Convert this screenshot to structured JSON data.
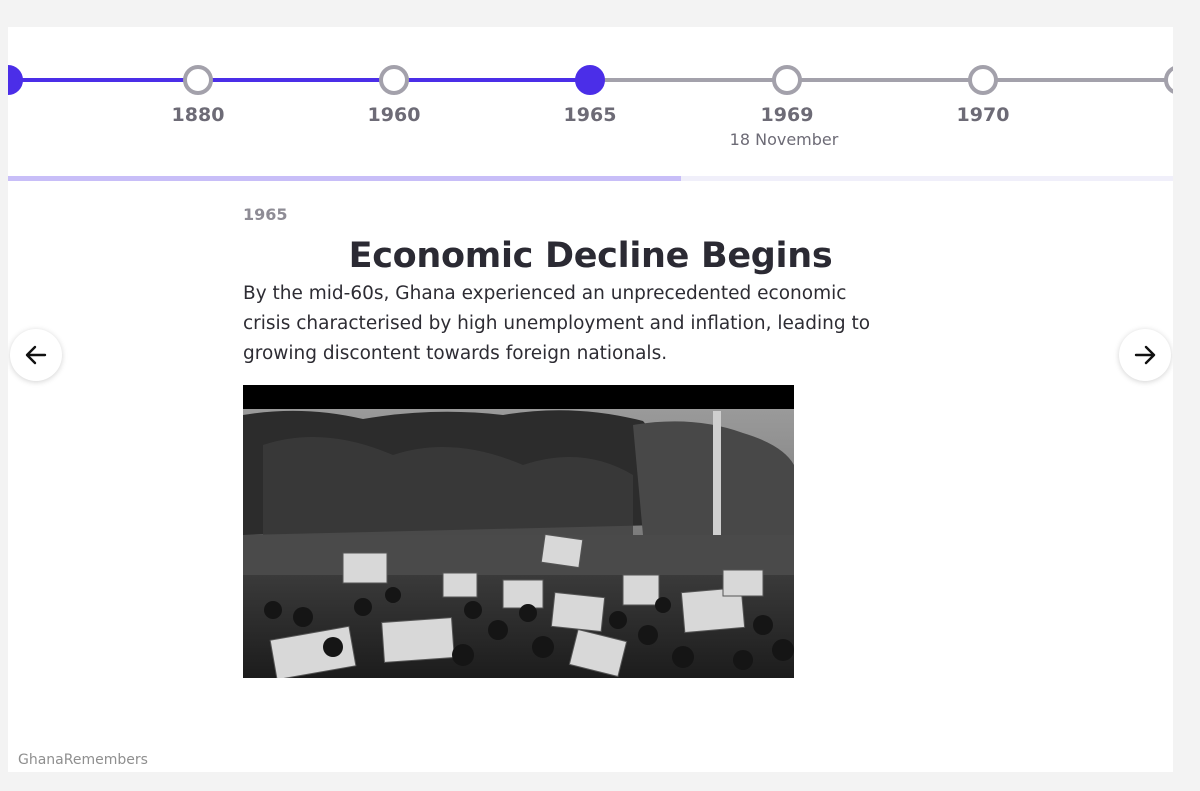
{
  "timeline": {
    "events": [
      {
        "year": "",
        "date": "",
        "state": "done"
      },
      {
        "year": "1880",
        "date": "",
        "state": "done"
      },
      {
        "year": "1960",
        "date": "",
        "state": "done"
      },
      {
        "year": "1965",
        "date": "",
        "state": "active"
      },
      {
        "year": "1969",
        "date": "18 November",
        "state": "upcoming"
      },
      {
        "year": "1970",
        "date": "",
        "state": "upcoming"
      },
      {
        "year": "",
        "date": "",
        "state": "upcoming"
      }
    ],
    "progress_fraction": 0.578,
    "colors": {
      "done": "#4b2ee8",
      "upcoming": "#a3a1ab",
      "progress": "#c8bef8"
    }
  },
  "slide": {
    "eyebrow": "1965",
    "title": "Economic Decline Begins",
    "body": "By the mid-60s, Ghana experienced an unprecedented economic crisis characterised by high unemployment and inflation, leading to growing discontent towards foreign nationals."
  },
  "navigation": {
    "prev_icon": "arrow-left-icon",
    "next_icon": "arrow-right-icon"
  },
  "footer": {
    "credit": "GhanaRemembers"
  }
}
